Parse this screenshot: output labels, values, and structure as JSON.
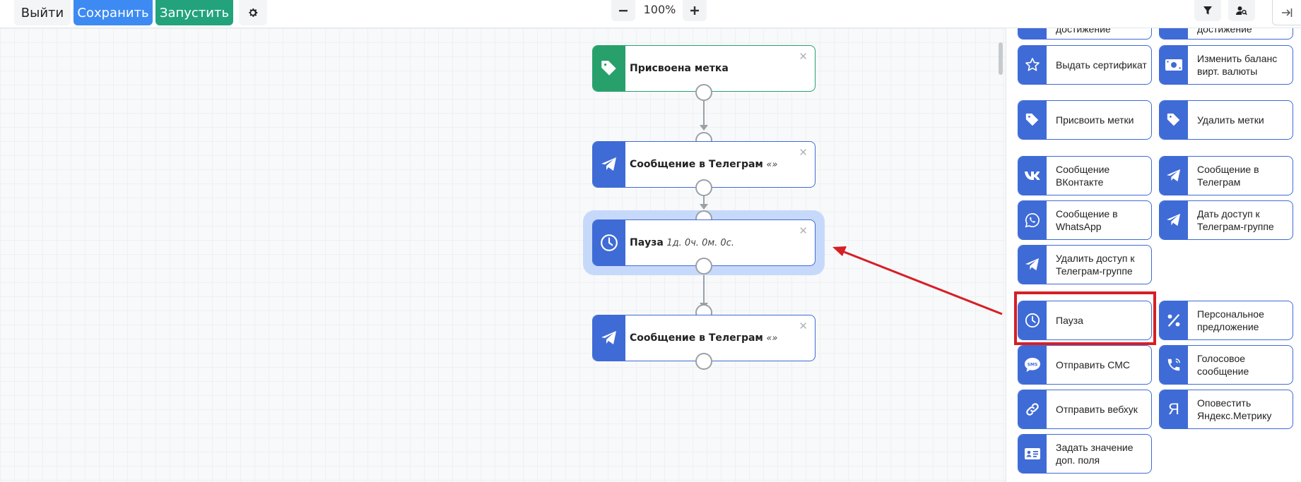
{
  "toolbar": {
    "exit_label": "Выйти",
    "save_label": "Сохранить",
    "run_label": "Запустить",
    "zoom_level": "100%"
  },
  "nodes": [
    {
      "title": "Присвоена метка",
      "detail": "",
      "icon": "tag-icon",
      "color": "#28a06c"
    },
    {
      "title": "Сообщение в Телеграм",
      "detail": "«»",
      "icon": "telegram-icon",
      "color": "#3f6bd6"
    },
    {
      "title": "Пауза",
      "detail": "1д. 0ч. 0м. 0с.",
      "icon": "clock-icon",
      "color": "#3f6bd6"
    },
    {
      "title": "Сообщение в Телеграм",
      "detail": "«»",
      "icon": "telegram-icon",
      "color": "#3f6bd6"
    }
  ],
  "node_close_glyph": "✕",
  "palette": {
    "items": [
      {
        "label": "Выдать сертификат",
        "icon": "star-icon"
      },
      {
        "label": "Изменить баланс вирт. валюты",
        "icon": "banknote-icon"
      },
      {
        "label": "Присвоить метки",
        "icon": "tag-icon"
      },
      {
        "label": "Удалить метки",
        "icon": "tag-icon"
      },
      {
        "label": "Сообщение ВКонтакте",
        "icon": "vk-icon"
      },
      {
        "label": "Сообщение в Телеграм",
        "icon": "telegram-icon"
      },
      {
        "label": "Сообщение в WhatsApp",
        "icon": "whatsapp-icon"
      },
      {
        "label": "Дать доступ к Телеграм-группе",
        "icon": "telegram-icon"
      },
      {
        "label": "Удалить доступ к Телеграм-группе",
        "icon": "telegram-icon"
      },
      {
        "label": "Пауза",
        "icon": "clock-icon"
      },
      {
        "label": "Персональное предложение",
        "icon": "percent-icon"
      },
      {
        "label": "Отправить СМС",
        "icon": "sms-icon"
      },
      {
        "label": "Голосовое сообщение",
        "icon": "phone-call-icon"
      },
      {
        "label": "Отправить вебхук",
        "icon": "link-icon"
      },
      {
        "label": "Оповестить Яндекс.Метрику",
        "icon": "yandex-icon"
      },
      {
        "label": "Задать значение доп. поля",
        "icon": "id-card-icon"
      }
    ],
    "partially_hidden_label_fragment": "достижение",
    "yandex_glyph": "Я"
  },
  "colors": {
    "primary": "#3d8bf2",
    "success": "#23a37c",
    "node_blue": "#3f6bd6",
    "node_green": "#28a06c",
    "selection": "#c7d9fb",
    "annotation_red": "#d61f26"
  }
}
